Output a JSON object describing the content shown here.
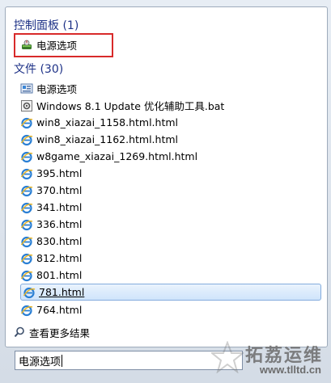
{
  "control_panel": {
    "title": "控制面板 (1)",
    "items": [
      {
        "label": "电源选项",
        "icon": "power-options-icon"
      }
    ]
  },
  "files": {
    "title": "文件 (30)",
    "items": [
      {
        "label": "电源选项",
        "icon": "power-options-file-icon"
      },
      {
        "label": "Windows 8.1 Update 优化辅助工具.bat",
        "icon": "bat-file-icon"
      },
      {
        "label": "win8_xiazai_1158.html.html",
        "icon": "ie-html-icon"
      },
      {
        "label": "win8_xiazai_1162.html.html",
        "icon": "ie-html-icon"
      },
      {
        "label": "w8game_xiazai_1269.html.html",
        "icon": "ie-html-icon"
      },
      {
        "label": "395.html",
        "icon": "ie-html-icon"
      },
      {
        "label": "370.html",
        "icon": "ie-html-icon"
      },
      {
        "label": "341.html",
        "icon": "ie-html-icon"
      },
      {
        "label": "336.html",
        "icon": "ie-html-icon"
      },
      {
        "label": "830.html",
        "icon": "ie-html-icon"
      },
      {
        "label": "812.html",
        "icon": "ie-html-icon"
      },
      {
        "label": "801.html",
        "icon": "ie-html-icon"
      },
      {
        "label": "781.html",
        "icon": "ie-html-icon"
      },
      {
        "label": "764.html",
        "icon": "ie-html-icon"
      }
    ],
    "selected_label": "781.html"
  },
  "more_results": {
    "label": "查看更多结果",
    "icon": "search-icon"
  },
  "search": {
    "value": "电源选项"
  },
  "watermark": {
    "brand": "拓荔运维",
    "url": "www.tlltd.cn"
  },
  "colors": {
    "group_title": "#1e3287",
    "highlight_border": "#d82a2a",
    "selection_border": "#84acdd",
    "ie_blue": "#2a7fd4"
  }
}
